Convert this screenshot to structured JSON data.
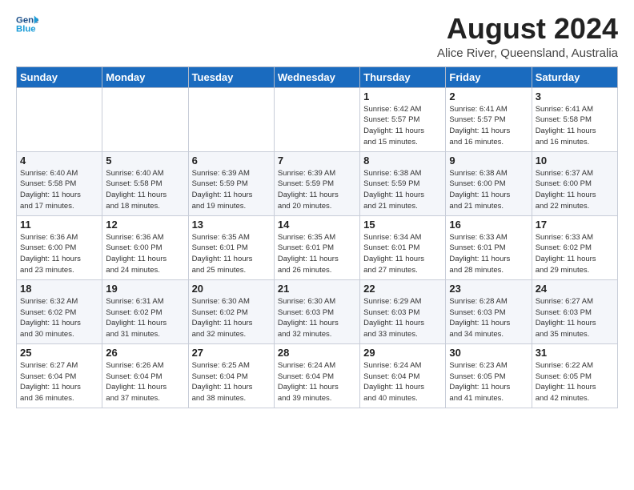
{
  "logo": {
    "line1": "General",
    "line2": "Blue"
  },
  "title": "August 2024",
  "location": "Alice River, Queensland, Australia",
  "days_of_week": [
    "Sunday",
    "Monday",
    "Tuesday",
    "Wednesday",
    "Thursday",
    "Friday",
    "Saturday"
  ],
  "weeks": [
    [
      {
        "day": "",
        "info": ""
      },
      {
        "day": "",
        "info": ""
      },
      {
        "day": "",
        "info": ""
      },
      {
        "day": "",
        "info": ""
      },
      {
        "day": "1",
        "info": "Sunrise: 6:42 AM\nSunset: 5:57 PM\nDaylight: 11 hours\nand 15 minutes."
      },
      {
        "day": "2",
        "info": "Sunrise: 6:41 AM\nSunset: 5:57 PM\nDaylight: 11 hours\nand 16 minutes."
      },
      {
        "day": "3",
        "info": "Sunrise: 6:41 AM\nSunset: 5:58 PM\nDaylight: 11 hours\nand 16 minutes."
      }
    ],
    [
      {
        "day": "4",
        "info": "Sunrise: 6:40 AM\nSunset: 5:58 PM\nDaylight: 11 hours\nand 17 minutes."
      },
      {
        "day": "5",
        "info": "Sunrise: 6:40 AM\nSunset: 5:58 PM\nDaylight: 11 hours\nand 18 minutes."
      },
      {
        "day": "6",
        "info": "Sunrise: 6:39 AM\nSunset: 5:59 PM\nDaylight: 11 hours\nand 19 minutes."
      },
      {
        "day": "7",
        "info": "Sunrise: 6:39 AM\nSunset: 5:59 PM\nDaylight: 11 hours\nand 20 minutes."
      },
      {
        "day": "8",
        "info": "Sunrise: 6:38 AM\nSunset: 5:59 PM\nDaylight: 11 hours\nand 21 minutes."
      },
      {
        "day": "9",
        "info": "Sunrise: 6:38 AM\nSunset: 6:00 PM\nDaylight: 11 hours\nand 21 minutes."
      },
      {
        "day": "10",
        "info": "Sunrise: 6:37 AM\nSunset: 6:00 PM\nDaylight: 11 hours\nand 22 minutes."
      }
    ],
    [
      {
        "day": "11",
        "info": "Sunrise: 6:36 AM\nSunset: 6:00 PM\nDaylight: 11 hours\nand 23 minutes."
      },
      {
        "day": "12",
        "info": "Sunrise: 6:36 AM\nSunset: 6:00 PM\nDaylight: 11 hours\nand 24 minutes."
      },
      {
        "day": "13",
        "info": "Sunrise: 6:35 AM\nSunset: 6:01 PM\nDaylight: 11 hours\nand 25 minutes."
      },
      {
        "day": "14",
        "info": "Sunrise: 6:35 AM\nSunset: 6:01 PM\nDaylight: 11 hours\nand 26 minutes."
      },
      {
        "day": "15",
        "info": "Sunrise: 6:34 AM\nSunset: 6:01 PM\nDaylight: 11 hours\nand 27 minutes."
      },
      {
        "day": "16",
        "info": "Sunrise: 6:33 AM\nSunset: 6:01 PM\nDaylight: 11 hours\nand 28 minutes."
      },
      {
        "day": "17",
        "info": "Sunrise: 6:33 AM\nSunset: 6:02 PM\nDaylight: 11 hours\nand 29 minutes."
      }
    ],
    [
      {
        "day": "18",
        "info": "Sunrise: 6:32 AM\nSunset: 6:02 PM\nDaylight: 11 hours\nand 30 minutes."
      },
      {
        "day": "19",
        "info": "Sunrise: 6:31 AM\nSunset: 6:02 PM\nDaylight: 11 hours\nand 31 minutes."
      },
      {
        "day": "20",
        "info": "Sunrise: 6:30 AM\nSunset: 6:02 PM\nDaylight: 11 hours\nand 32 minutes."
      },
      {
        "day": "21",
        "info": "Sunrise: 6:30 AM\nSunset: 6:03 PM\nDaylight: 11 hours\nand 32 minutes."
      },
      {
        "day": "22",
        "info": "Sunrise: 6:29 AM\nSunset: 6:03 PM\nDaylight: 11 hours\nand 33 minutes."
      },
      {
        "day": "23",
        "info": "Sunrise: 6:28 AM\nSunset: 6:03 PM\nDaylight: 11 hours\nand 34 minutes."
      },
      {
        "day": "24",
        "info": "Sunrise: 6:27 AM\nSunset: 6:03 PM\nDaylight: 11 hours\nand 35 minutes."
      }
    ],
    [
      {
        "day": "25",
        "info": "Sunrise: 6:27 AM\nSunset: 6:04 PM\nDaylight: 11 hours\nand 36 minutes."
      },
      {
        "day": "26",
        "info": "Sunrise: 6:26 AM\nSunset: 6:04 PM\nDaylight: 11 hours\nand 37 minutes."
      },
      {
        "day": "27",
        "info": "Sunrise: 6:25 AM\nSunset: 6:04 PM\nDaylight: 11 hours\nand 38 minutes."
      },
      {
        "day": "28",
        "info": "Sunrise: 6:24 AM\nSunset: 6:04 PM\nDaylight: 11 hours\nand 39 minutes."
      },
      {
        "day": "29",
        "info": "Sunrise: 6:24 AM\nSunset: 6:04 PM\nDaylight: 11 hours\nand 40 minutes."
      },
      {
        "day": "30",
        "info": "Sunrise: 6:23 AM\nSunset: 6:05 PM\nDaylight: 11 hours\nand 41 minutes."
      },
      {
        "day": "31",
        "info": "Sunrise: 6:22 AM\nSunset: 6:05 PM\nDaylight: 11 hours\nand 42 minutes."
      }
    ]
  ]
}
